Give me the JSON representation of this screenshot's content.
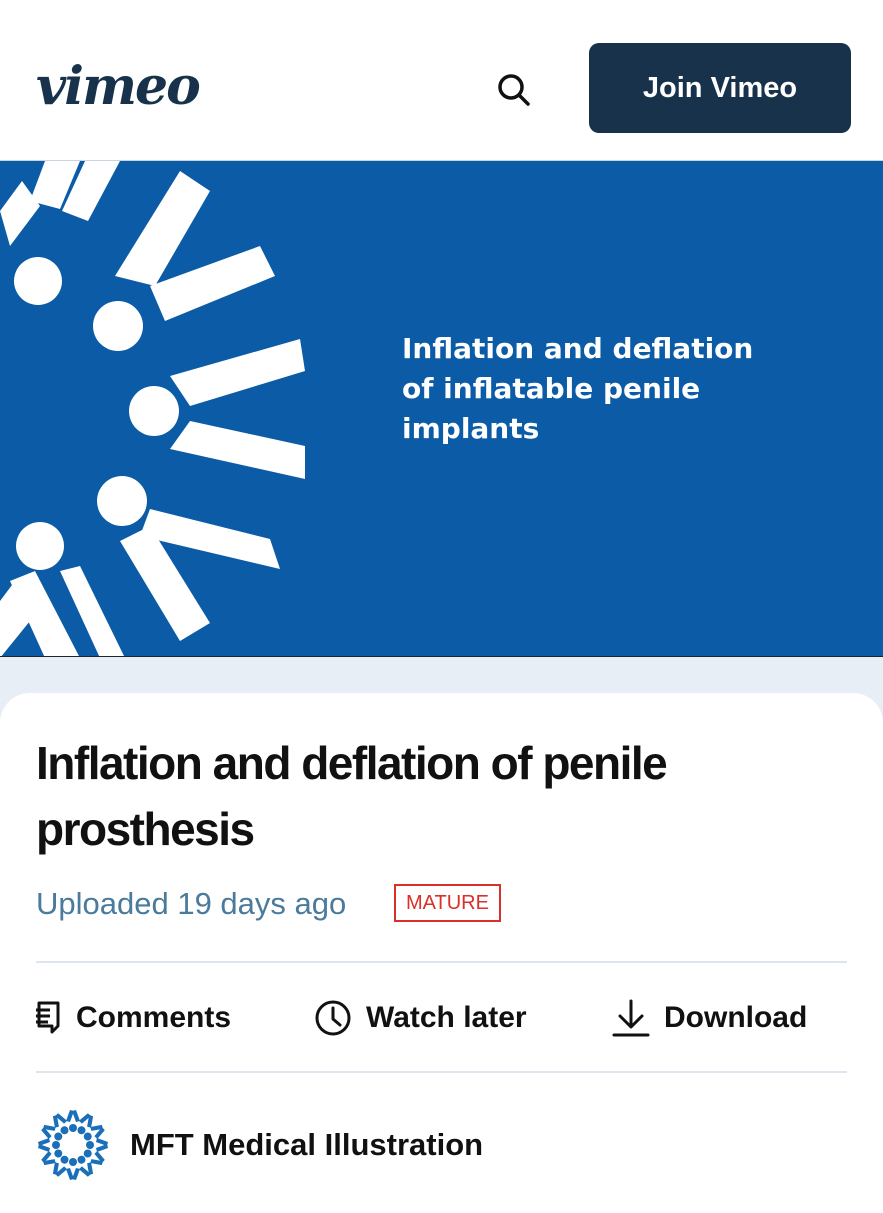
{
  "header": {
    "logo_text": "vimeo",
    "search_icon": "search-icon",
    "join_label": "Join Vimeo"
  },
  "video": {
    "title_lines": [
      "Inflation and deflation",
      "of inflatable penile",
      "implants"
    ],
    "background_color": "#0b5ba6"
  },
  "details": {
    "title": "Inflation and deflation of penile prosthesis",
    "uploaded": "Uploaded 19 days ago",
    "badge": "MATURE"
  },
  "actions": [
    {
      "label": "Comments",
      "icon": "comments-icon"
    },
    {
      "label": "Watch later",
      "icon": "clock-icon"
    },
    {
      "label": "Download",
      "icon": "download-icon"
    }
  ],
  "channel": {
    "name": "MFT Medical Illustration",
    "avatar_icon": "mft-logo-icon"
  },
  "colors": {
    "brand": "#17324a",
    "accent_blue": "#0b5ba6",
    "mature_red": "#d9302a",
    "meta_text": "#4a7a9c"
  }
}
